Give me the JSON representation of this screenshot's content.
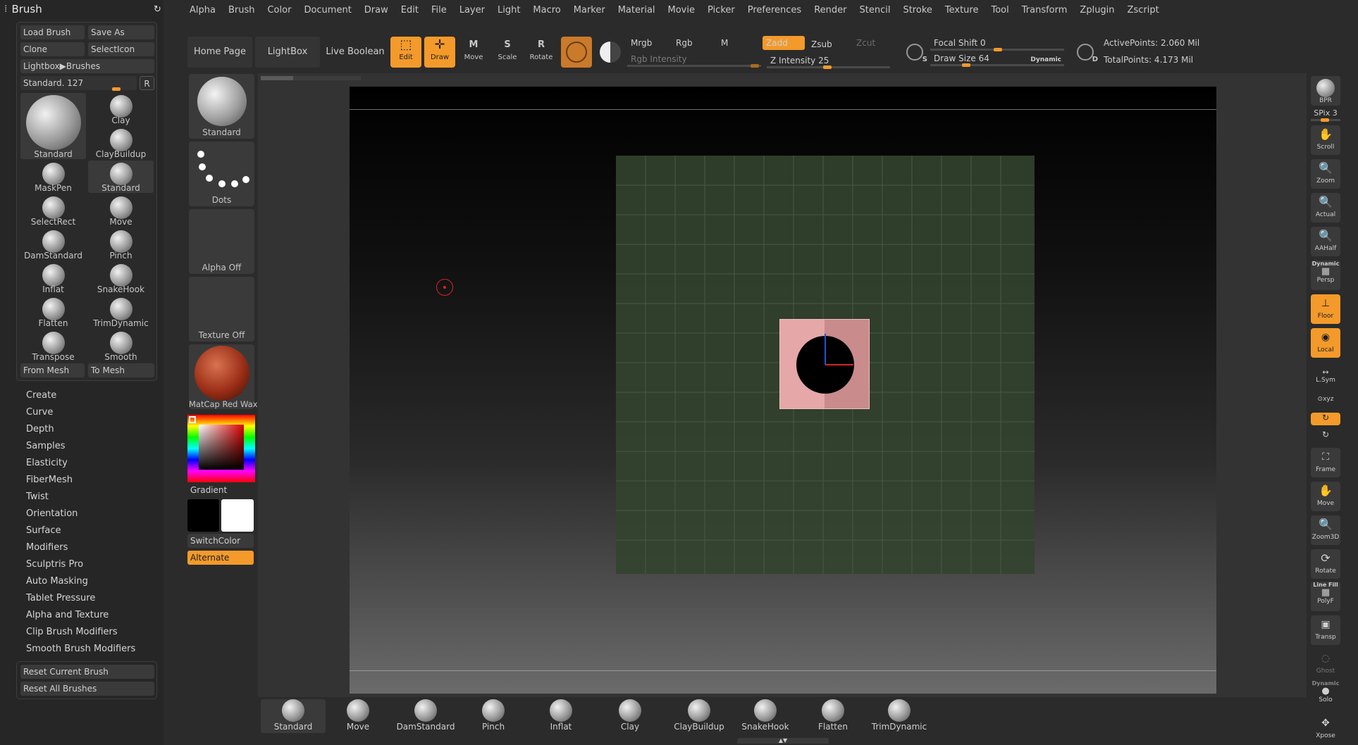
{
  "menu": [
    "Alpha",
    "Brush",
    "Color",
    "Document",
    "Draw",
    "Edit",
    "File",
    "Layer",
    "Light",
    "Macro",
    "Marker",
    "Material",
    "Movie",
    "Picker",
    "Preferences",
    "Render",
    "Stencil",
    "Stroke",
    "Texture",
    "Tool",
    "Transform",
    "Zplugin",
    "Zscript"
  ],
  "brush_palette": {
    "title": "Brush",
    "load_brush": "Load Brush",
    "save_as": "Save As",
    "clone": "Clone",
    "select_icon": "SelectIcon",
    "lightbox_brushes": "Lightbox▶Brushes",
    "current": "Standard. 127",
    "r_label": "R",
    "brushes": [
      "Standard",
      "Clay",
      "ClayBuildup",
      "MaskPen",
      "Standard",
      "SelectRect",
      "Move",
      "DamStandard",
      "Pinch",
      "Inflat",
      "SnakeHook",
      "Flatten",
      "TrimDynamic",
      "Transpose",
      "Smooth"
    ],
    "from_mesh": "From Mesh",
    "to_mesh": "To Mesh",
    "subpalettes": [
      "Create",
      "Curve",
      "Depth",
      "Samples",
      "Elasticity",
      "FiberMesh",
      "Twist",
      "Orientation",
      "Surface",
      "Modifiers",
      "Sculptris Pro",
      "Auto Masking",
      "Tablet Pressure",
      "Alpha and Texture",
      "Clip Brush Modifiers",
      "Smooth Brush Modifiers"
    ],
    "reset_current": "Reset Current Brush",
    "reset_all": "Reset All Brushes"
  },
  "tool_shelf": {
    "brush": "Standard",
    "stroke": "Dots",
    "alpha": "Alpha Off",
    "texture": "Texture Off",
    "material": "MatCap Red Wax",
    "gradient": "Gradient",
    "switch_color": "SwitchColor",
    "alternate": "Alternate"
  },
  "top_bar": {
    "home_page": "Home Page",
    "lightbox": "LightBox",
    "live_boolean": "Live Boolean",
    "edit": "Edit",
    "draw": "Draw",
    "move": "Move",
    "scale": "Scale",
    "rotate": "Rotate",
    "move_key": "M",
    "scale_key": "S",
    "rotate_key": "R",
    "mrgb": "Mrgb",
    "rgb": "Rgb",
    "m": "M",
    "zadd": "Zadd",
    "zsub": "Zsub",
    "zcut": "Zcut",
    "rgb_intensity": "Rgb Intensity",
    "z_intensity": "Z Intensity 25",
    "focal_shift": "Focal Shift 0",
    "draw_size": "Draw Size 64",
    "dynamic": "Dynamic",
    "active_points": "ActivePoints: 2.060 Mil",
    "total_points": "TotalPoints: 4.173 Mil",
    "s_key": "S",
    "d_key": "D"
  },
  "right_shelf": {
    "bpr": "BPR",
    "spix": "SPix 3",
    "scroll": "Scroll",
    "zoom": "Zoom",
    "actual": "Actual",
    "aahalf": "AAHalf",
    "dynamic": "Dynamic",
    "persp": "Persp",
    "floor": "Floor",
    "local": "Local",
    "lsym": "L.Sym",
    "xyz": "⊙xyz",
    "frame": "Frame",
    "move": "Move",
    "zoom3d": "Zoom3D",
    "rotate": "Rotate",
    "line_fill": "Line Fill",
    "polyf": "PolyF",
    "transp": "Transp",
    "ghost": "Ghost",
    "dynamic2": "Dynamic",
    "solo": "Solo",
    "xpose": "Xpose"
  },
  "bottom_shelf": [
    "Standard",
    "Move",
    "DamStandard",
    "Pinch",
    "Inflat",
    "Clay",
    "ClayBuildup",
    "SnakeHook",
    "Flatten",
    "TrimDynamic"
  ],
  "colors": {
    "accent": "#f39a2b",
    "panel": "#262626",
    "viewport_top": "#000000",
    "mesh_plane": "#33432f",
    "mesh_object": "#e3a5a5"
  }
}
